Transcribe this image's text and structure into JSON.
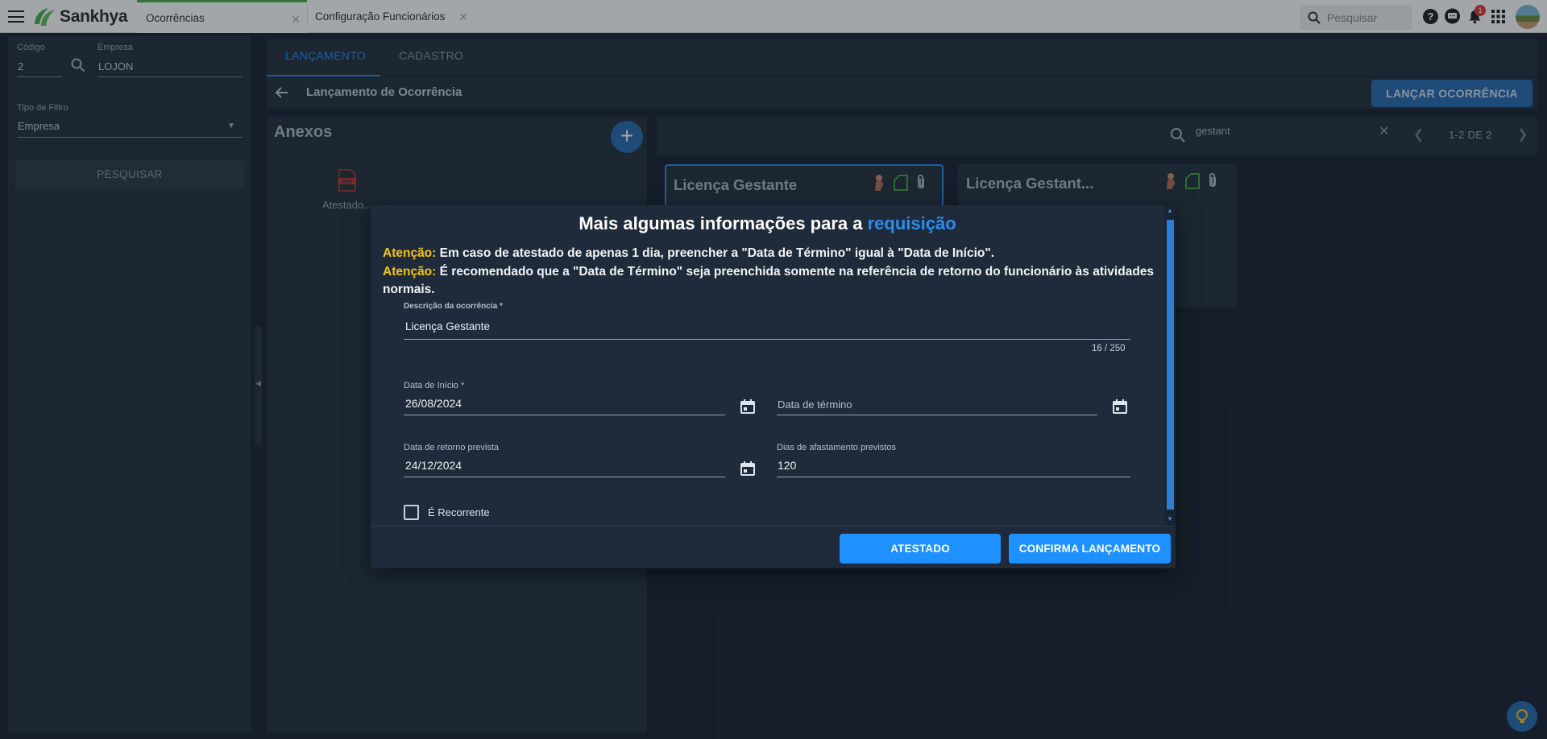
{
  "topbar": {
    "logo_text": "Sankhya",
    "tabs": [
      {
        "label": "Ocorrências",
        "active": true
      },
      {
        "label": "Configuração Funcionários",
        "active": false
      }
    ],
    "search_placeholder": "Pesquisar",
    "notification_count": "1",
    "icons": [
      "menu-icon",
      "help-icon",
      "chat-icon",
      "bell-icon",
      "apps-grid-icon"
    ]
  },
  "filter_panel": {
    "codigo_label": "Código",
    "codigo_value": "2",
    "empresa_label": "Empresa",
    "empresa_value": "LOJON",
    "tipo_filtro_label": "Tipo de Filtro",
    "tipo_filtro_value": "Empresa",
    "search_button": "PESQUISAR"
  },
  "main": {
    "tabs": [
      {
        "label": "LANÇAMENTO",
        "active": true
      },
      {
        "label": "CADASTRO",
        "active": false
      }
    ],
    "title": "Lançamento de Ocorrência",
    "action_button": "LANÇAR OCORRÊNCIA"
  },
  "anexos": {
    "title": "Anexos",
    "files": [
      {
        "label": "Atestado...",
        "type": "PDF"
      }
    ]
  },
  "cards_toolbar": {
    "search_value": "gestant",
    "page_info": "1-2 DE 2"
  },
  "cards": [
    {
      "title": "Licença Gestante",
      "selected": true
    },
    {
      "title": "Licença Gestant...",
      "selected": false
    }
  ],
  "modal": {
    "title_prefix": "Mais algumas informações para a ",
    "title_highlight": "requisição",
    "warnings": [
      {
        "label": "Atenção:",
        "text": " Em caso de atestado de apenas 1 dia, preencher a \"Data de Término\" igual à \"Data de Início\"."
      },
      {
        "label": "Atenção:",
        "text": " É recomendado que a \"Data de Término\" seja preenchida somente na referência de retorno do funcionário às atividades normais."
      }
    ],
    "descricao_label": "Descrição da ocorrência *",
    "descricao_value": "Licença Gestante",
    "descricao_counter": "16 / 250",
    "data_inicio_label": "Data de Início *",
    "data_inicio_value": "26/08/2024",
    "data_termino_placeholder": "Data de término",
    "data_retorno_label": "Data de retorno prevista",
    "data_retorno_value": "24/12/2024",
    "dias_label": "Dias de afastamento previstos",
    "dias_value": "120",
    "recorrente_label": "É Recorrente",
    "recorrente_checked": false,
    "btn_atestado": "ATESTADO",
    "btn_confirma": "CONFIRMA LANÇAMENTO"
  },
  "colors": {
    "accent": "#1e90ff",
    "warning": "#f5c518",
    "brand_green": "#4caf50",
    "background": "#1b2532",
    "panel": "#263240"
  }
}
